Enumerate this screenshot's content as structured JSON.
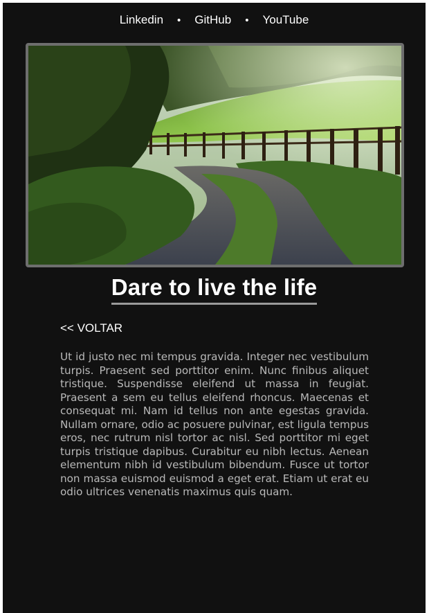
{
  "nav": {
    "links": [
      {
        "label": "Linkedin"
      },
      {
        "label": "GitHub"
      },
      {
        "label": "YouTube"
      }
    ],
    "separator": "•"
  },
  "hero": {
    "image_subject": "country path with wooden fence and green field",
    "colors": {
      "field": "#7db33c",
      "trees": "#2a3d1a",
      "path": "#4a4e58"
    }
  },
  "article": {
    "title": "Dare to live the life",
    "back_label": "<< VOLTAR",
    "body": "Ut id justo nec mi tempus gravida. Integer nec vestibulum turpis. Praesent sed porttitor enim. Nunc finibus aliquet tristique. Suspendisse eleifend ut massa in feugiat. Praesent a sem eu tellus eleifend rhoncus. Maecenas et consequat mi. Nam id tellus non ante egestas gravida. Nullam ornare, odio ac posuere pulvinar, est ligula tempus eros, nec rutrum nisl tortor ac nisl. Sed porttitor mi eget turpis tristique dapibus. Curabitur eu nibh lectus. Aenean elementum nibh id vestibulum bibendum. Fusce ut tortor non massa euismod euismod a eget erat. Etiam ut erat eu odio ultrices venenatis maximus quis quam."
  },
  "theme": {
    "background": "#111111",
    "text": "#ffffff",
    "body_text": "#b9b9b9",
    "border": "#6e6e6e"
  }
}
